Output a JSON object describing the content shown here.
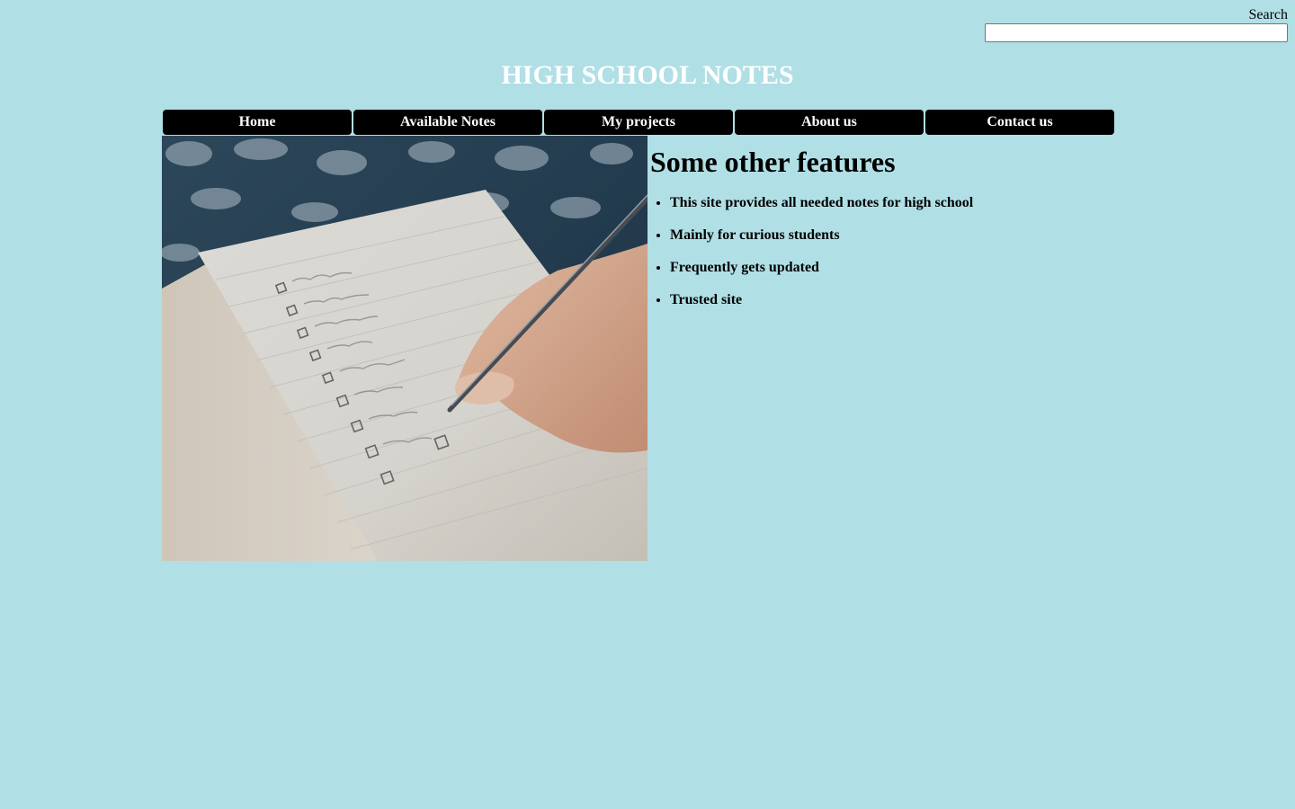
{
  "search": {
    "label": "Search",
    "value": "",
    "placeholder": ""
  },
  "header": {
    "title": "HIGH SCHOOL NOTES"
  },
  "nav": {
    "items": [
      {
        "label": "Home"
      },
      {
        "label": "Available Notes"
      },
      {
        "label": "My projects"
      },
      {
        "label": "About us"
      },
      {
        "label": "Contact us"
      }
    ]
  },
  "main": {
    "image_icon": "notebook-checklist-photo",
    "features_title": "Some other features",
    "features": [
      "This site provides all needed notes for high school",
      "Mainly for curious students",
      "Frequently gets updated",
      "Trusted site"
    ]
  },
  "colors": {
    "background": "#b0dfe5",
    "nav_background": "#000000",
    "title_color": "#ffffff"
  }
}
